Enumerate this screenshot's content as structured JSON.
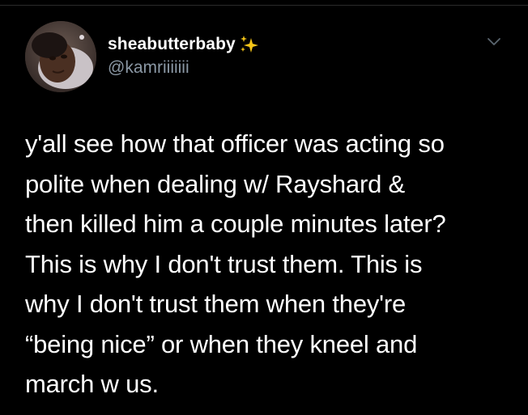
{
  "tweet": {
    "display_name": "sheabutterbaby",
    "handle": "@kamriiiiiii",
    "lines": [
      "y'all see how that officer was acting so",
      "polite when dealing w/ Rayshard &",
      "then killed him a couple minutes later?",
      "This is why I don't trust them. This is",
      "why I don't trust them when they're",
      "“being nice” or when they kneel and",
      "march w us."
    ]
  },
  "icons": {
    "name_emoji": "sparkles-icon",
    "menu": "chevron-down-icon",
    "avatar": "avatar"
  },
  "colors": {
    "background": "#000000",
    "text_primary": "#ffffff",
    "text_secondary": "#8b98a5",
    "sparkle": "#f5c518"
  }
}
